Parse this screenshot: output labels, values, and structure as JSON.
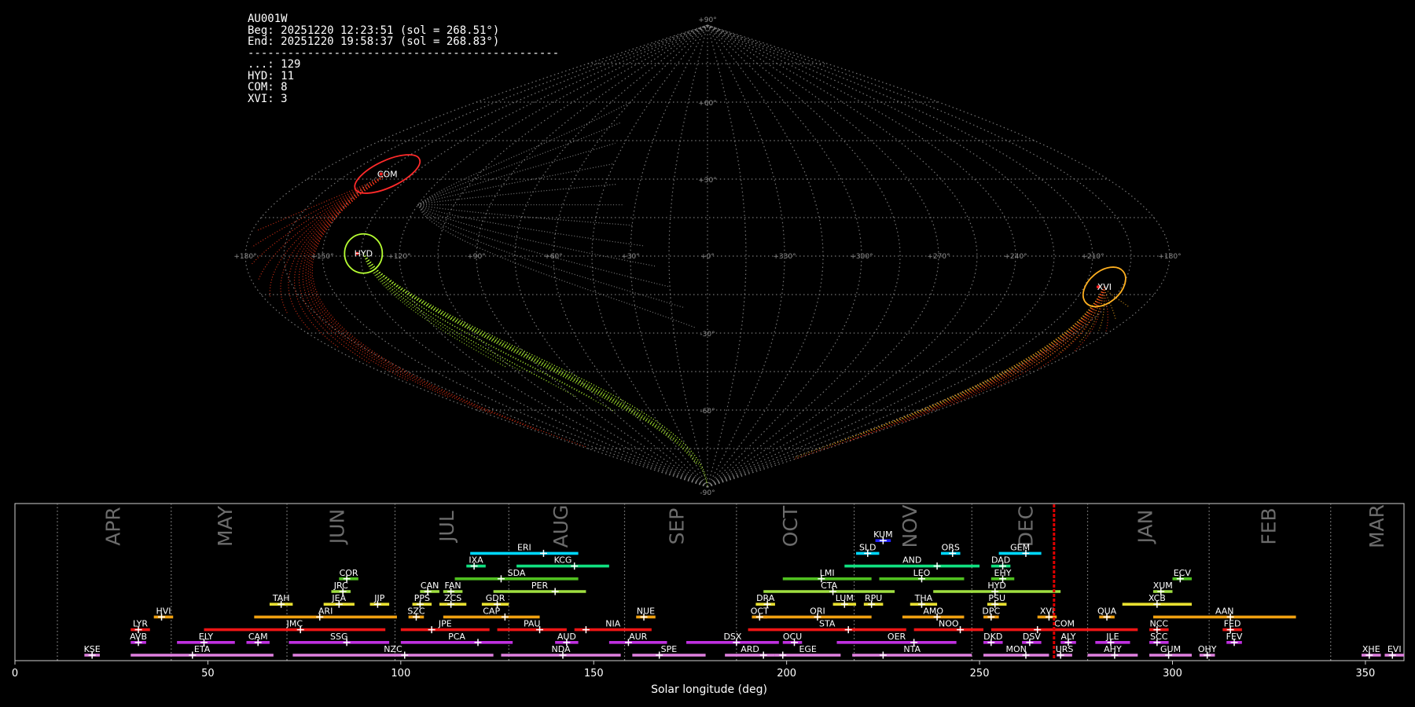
{
  "info": {
    "station": "AU001W",
    "begin": "Beg: 20251220 12:23:51 (sol = 268.51°)",
    "end": "End: 20251220 19:58:37 (sol = 268.83°)",
    "separator": "-----------------------------------------------",
    "counts": [
      "...: 129",
      "HYD: 11",
      "COM: 8",
      "XVI: 3"
    ]
  },
  "chart_data": [
    {
      "type": "scatter",
      "projection": "sinusoidal",
      "lat_ticks": [
        {
          "lat": 90,
          "label": "+90°"
        },
        {
          "lat": 60,
          "label": "+60°"
        },
        {
          "lat": 30,
          "label": "+30°"
        },
        {
          "lat": -30,
          "label": "-30°"
        },
        {
          "lat": -60,
          "label": "-60°"
        },
        {
          "lat": -90,
          "label": "-90°"
        }
      ],
      "lon_ticks": [
        {
          "lon": -180,
          "label": "+180°"
        },
        {
          "lon": -150,
          "label": "+150°"
        },
        {
          "lon": -120,
          "label": "+120°"
        },
        {
          "lon": -90,
          "label": "+90°"
        },
        {
          "lon": -60,
          "label": "+60°"
        },
        {
          "lon": -30,
          "label": "+30°"
        },
        {
          "lon": 0,
          "label": "+0°"
        },
        {
          "lon": 30,
          "label": "+330°"
        },
        {
          "lon": 60,
          "label": "+300°"
        },
        {
          "lon": 90,
          "label": "+270°"
        },
        {
          "lon": 120,
          "label": "+240°"
        },
        {
          "lon": 150,
          "label": "+210°"
        },
        {
          "lon": 180,
          "label": "+180°"
        }
      ],
      "radiants": [
        {
          "code": "COM",
          "lon": -147,
          "lat": 32,
          "color": "#ff2a2a"
        },
        {
          "code": "HYD",
          "lon": -134,
          "lat": 1,
          "color": "#b7ff33"
        },
        {
          "code": "XVI",
          "lon": 158,
          "lat": -12,
          "color": "#ffb020"
        }
      ]
    },
    {
      "type": "bar",
      "xlabel": "Solar longitude (deg)",
      "xlim": [
        0,
        360
      ],
      "xticks": [
        0,
        50,
        100,
        150,
        200,
        250,
        300,
        350
      ],
      "current_sol": 269.3,
      "month_boundaries": [
        11,
        40.5,
        70.5,
        98.5,
        128,
        158,
        187,
        217.5,
        248,
        278,
        309.5,
        341
      ],
      "months": [
        {
          "name": "APR",
          "pos": 25.5
        },
        {
          "name": "MAY",
          "pos": 54.5
        },
        {
          "name": "JUN",
          "pos": 83.5
        },
        {
          "name": "JUL",
          "pos": 112
        },
        {
          "name": "AUG",
          "pos": 141.5
        },
        {
          "name": "SEP",
          "pos": 171.5
        },
        {
          "name": "OCT",
          "pos": 201
        },
        {
          "name": "NOV",
          "pos": 232
        },
        {
          "name": "DEC",
          "pos": 262
        },
        {
          "name": "JAN",
          "pos": 293
        },
        {
          "name": "FEB",
          "pos": 325
        },
        {
          "name": "MAR",
          "pos": 353
        }
      ],
      "showers": [
        {
          "code": "KUM",
          "start": 223,
          "end": 227,
          "peak": 225,
          "row": 9,
          "color": "#2222ff"
        },
        {
          "code": "ERI",
          "start": 118,
          "end": 146,
          "peak": 137,
          "row": 8,
          "color": "#00d8ff"
        },
        {
          "code": "SLD",
          "start": 218,
          "end": 224,
          "peak": 221,
          "row": 8,
          "color": "#00d8ff"
        },
        {
          "code": "ORS",
          "start": 240,
          "end": 245,
          "peak": 243,
          "row": 8,
          "color": "#00d8ff"
        },
        {
          "code": "GEM",
          "start": 255,
          "end": 266,
          "peak": 262,
          "row": 8,
          "color": "#00d8ff"
        },
        {
          "code": "IXA",
          "start": 117,
          "end": 122,
          "peak": 119,
          "row": 7,
          "color": "#10e080"
        },
        {
          "code": "KCG",
          "start": 130,
          "end": 154,
          "peak": 145,
          "row": 7,
          "color": "#10e080"
        },
        {
          "code": "AND",
          "start": 215,
          "end": 250,
          "peak": 239,
          "row": 7,
          "color": "#10e080"
        },
        {
          "code": "DAD",
          "start": 253,
          "end": 258,
          "peak": 256,
          "row": 7,
          "color": "#10e080"
        },
        {
          "code": "COR",
          "start": 84,
          "end": 89,
          "peak": 86,
          "row": 6,
          "color": "#50c020"
        },
        {
          "code": "SDA",
          "start": 114,
          "end": 146,
          "peak": 126,
          "row": 6,
          "color": "#50c020"
        },
        {
          "code": "LMI",
          "start": 199,
          "end": 222,
          "peak": 209,
          "row": 6,
          "color": "#50c020"
        },
        {
          "code": "LEO",
          "start": 224,
          "end": 246,
          "peak": 235,
          "row": 6,
          "color": "#50c020"
        },
        {
          "code": "EHY",
          "start": 253,
          "end": 259,
          "peak": 256,
          "row": 6,
          "color": "#50c020"
        },
        {
          "code": "ECV",
          "start": 300,
          "end": 305,
          "peak": 302,
          "row": 6,
          "color": "#50c020"
        },
        {
          "code": "JRC",
          "start": 82,
          "end": 87,
          "peak": 85,
          "row": 5,
          "color": "#a0e040"
        },
        {
          "code": "CAN",
          "start": 105,
          "end": 110,
          "peak": 107,
          "row": 5,
          "color": "#a0e040"
        },
        {
          "code": "FAN",
          "start": 111,
          "end": 116,
          "peak": 113,
          "row": 5,
          "color": "#a0e040"
        },
        {
          "code": "PER",
          "start": 124,
          "end": 148,
          "peak": 140,
          "row": 5,
          "color": "#a0e040"
        },
        {
          "code": "CTA",
          "start": 194,
          "end": 228,
          "peak": 212,
          "row": 5,
          "color": "#a0e040"
        },
        {
          "code": "HYD",
          "start": 238,
          "end": 271,
          "peak": 254,
          "row": 5,
          "color": "#a0e040"
        },
        {
          "code": "XUM",
          "start": 295,
          "end": 300,
          "peak": 297,
          "row": 5,
          "color": "#a0e040"
        },
        {
          "code": "TAH",
          "start": 66,
          "end": 72,
          "peak": 69,
          "row": 4,
          "color": "#e8e030"
        },
        {
          "code": "JEA",
          "start": 80,
          "end": 88,
          "peak": 84,
          "row": 4,
          "color": "#e8e030"
        },
        {
          "code": "JIP",
          "start": 92,
          "end": 97,
          "peak": 94,
          "row": 4,
          "color": "#e8e030"
        },
        {
          "code": "PPS",
          "start": 103,
          "end": 108,
          "peak": 105,
          "row": 4,
          "color": "#e8e030"
        },
        {
          "code": "ZCS",
          "start": 110,
          "end": 117,
          "peak": 113,
          "row": 4,
          "color": "#e8e030"
        },
        {
          "code": "GDR",
          "start": 121,
          "end": 128,
          "peak": 125,
          "row": 4,
          "color": "#e8e030"
        },
        {
          "code": "DRA",
          "start": 192,
          "end": 197,
          "peak": 195,
          "row": 4,
          "color": "#e8e030"
        },
        {
          "code": "LUM",
          "start": 212,
          "end": 218,
          "peak": 215,
          "row": 4,
          "color": "#e8e030"
        },
        {
          "code": "RPU",
          "start": 220,
          "end": 225,
          "peak": 222,
          "row": 4,
          "color": "#e8e030"
        },
        {
          "code": "THA",
          "start": 232,
          "end": 239,
          "peak": 235,
          "row": 4,
          "color": "#e8e030"
        },
        {
          "code": "PSU",
          "start": 252,
          "end": 257,
          "peak": 254,
          "row": 4,
          "color": "#e8e030"
        },
        {
          "code": "XCB",
          "start": 287,
          "end": 305,
          "peak": 296,
          "row": 4,
          "color": "#e8e030"
        },
        {
          "code": "HVI",
          "start": 36,
          "end": 41,
          "peak": 38,
          "row": 3,
          "color": "#f0a010"
        },
        {
          "code": "ARI",
          "start": 62,
          "end": 99,
          "peak": 79,
          "row": 3,
          "color": "#f0a010"
        },
        {
          "code": "SZC",
          "start": 102,
          "end": 106,
          "peak": 104,
          "row": 3,
          "color": "#f0a010"
        },
        {
          "code": "CAP",
          "start": 111,
          "end": 136,
          "peak": 127,
          "row": 3,
          "color": "#f0a010"
        },
        {
          "code": "NUE",
          "start": 161,
          "end": 166,
          "peak": 163,
          "row": 3,
          "color": "#f0a010"
        },
        {
          "code": "OCT",
          "start": 191,
          "end": 195,
          "peak": 193,
          "row": 3,
          "color": "#f0a010"
        },
        {
          "code": "ORI",
          "start": 194,
          "end": 222,
          "peak": 208,
          "row": 3,
          "color": "#f0a010"
        },
        {
          "code": "AMO",
          "start": 230,
          "end": 246,
          "peak": 239,
          "row": 3,
          "color": "#f0a010"
        },
        {
          "code": "DPC",
          "start": 251,
          "end": 255,
          "peak": 253,
          "row": 3,
          "color": "#f0a010"
        },
        {
          "code": "XVI",
          "start": 265,
          "end": 270,
          "peak": 268,
          "row": 3,
          "color": "#f0a010"
        },
        {
          "code": "QUA",
          "start": 281,
          "end": 285,
          "peak": 283,
          "row": 3,
          "color": "#f0a010"
        },
        {
          "code": "AAN",
          "start": 295,
          "end": 332,
          "peak": 315,
          "row": 3,
          "color": "#f0a010"
        },
        {
          "code": "LYR",
          "start": 30,
          "end": 35,
          "peak": 32,
          "row": 2,
          "color": "#ee1515"
        },
        {
          "code": "JMC",
          "start": 49,
          "end": 96,
          "peak": 74,
          "row": 2,
          "color": "#ee1515"
        },
        {
          "code": "JPE",
          "start": 100,
          "end": 123,
          "peak": 108,
          "row": 2,
          "color": "#ee1515"
        },
        {
          "code": "PAU",
          "start": 125,
          "end": 143,
          "peak": 136,
          "row": 2,
          "color": "#ee1515"
        },
        {
          "code": "NIA",
          "start": 145,
          "end": 165,
          "peak": 148,
          "row": 2,
          "color": "#ee1515"
        },
        {
          "code": "STA",
          "start": 190,
          "end": 231,
          "peak": 216,
          "row": 2,
          "color": "#ee1515"
        },
        {
          "code": "NOO",
          "start": 233,
          "end": 251,
          "peak": 245,
          "row": 2,
          "color": "#ee1515"
        },
        {
          "code": "COM",
          "start": 253,
          "end": 291,
          "peak": 265,
          "row": 2,
          "color": "#ee1515"
        },
        {
          "code": "NCC",
          "start": 294,
          "end": 299,
          "peak": 296,
          "row": 2,
          "color": "#ee1515"
        },
        {
          "code": "FED",
          "start": 313,
          "end": 318,
          "peak": 315,
          "row": 2,
          "color": "#ee1515"
        },
        {
          "code": "AVB",
          "start": 30,
          "end": 34,
          "peak": 32,
          "row": 1,
          "color": "#c030e0"
        },
        {
          "code": "ELY",
          "start": 42,
          "end": 57,
          "peak": 49,
          "row": 1,
          "color": "#c030e0"
        },
        {
          "code": "CAM",
          "start": 60,
          "end": 66,
          "peak": 63,
          "row": 1,
          "color": "#c030e0"
        },
        {
          "code": "SSG",
          "start": 71,
          "end": 97,
          "peak": 86,
          "row": 1,
          "color": "#c030e0"
        },
        {
          "code": "PCA",
          "start": 100,
          "end": 129,
          "peak": 120,
          "row": 1,
          "color": "#c030e0"
        },
        {
          "code": "AUD",
          "start": 140,
          "end": 146,
          "peak": 143,
          "row": 1,
          "color": "#c030e0"
        },
        {
          "code": "AUR",
          "start": 154,
          "end": 169,
          "peak": 159,
          "row": 1,
          "color": "#c030e0"
        },
        {
          "code": "DSX",
          "start": 174,
          "end": 198,
          "peak": 187,
          "row": 1,
          "color": "#c030e0"
        },
        {
          "code": "OCU",
          "start": 199,
          "end": 204,
          "peak": 202,
          "row": 1,
          "color": "#c030e0"
        },
        {
          "code": "OER",
          "start": 213,
          "end": 244,
          "peak": 233,
          "row": 1,
          "color": "#c030e0"
        },
        {
          "code": "DKD",
          "start": 251,
          "end": 256,
          "peak": 253,
          "row": 1,
          "color": "#c030e0"
        },
        {
          "code": "DSV",
          "start": 261,
          "end": 266,
          "peak": 263,
          "row": 1,
          "color": "#c030e0"
        },
        {
          "code": "ALY",
          "start": 271,
          "end": 275,
          "peak": 273,
          "row": 1,
          "color": "#c030e0"
        },
        {
          "code": "JLE",
          "start": 280,
          "end": 289,
          "peak": 284,
          "row": 1,
          "color": "#c030e0"
        },
        {
          "code": "SCC",
          "start": 294,
          "end": 299,
          "peak": 296,
          "row": 1,
          "color": "#c030e0"
        },
        {
          "code": "FEV",
          "start": 314,
          "end": 318,
          "peak": 316,
          "row": 1,
          "color": "#c030e0"
        },
        {
          "code": "KSE",
          "start": 18,
          "end": 22,
          "peak": 20,
          "row": 0,
          "color": "#e080e0"
        },
        {
          "code": "ETA",
          "start": 30,
          "end": 67,
          "peak": 46,
          "row": 0,
          "color": "#e080e0"
        },
        {
          "code": "NZC",
          "start": 72,
          "end": 124,
          "peak": 101,
          "row": 0,
          "color": "#e080e0"
        },
        {
          "code": "NDA",
          "start": 126,
          "end": 157,
          "peak": 142,
          "row": 0,
          "color": "#e080e0"
        },
        {
          "code": "SPE",
          "start": 160,
          "end": 179,
          "peak": 167,
          "row": 0,
          "color": "#e080e0"
        },
        {
          "code": "ARD",
          "start": 184,
          "end": 197,
          "peak": 194,
          "row": 0,
          "color": "#e080e0"
        },
        {
          "code": "EGE",
          "start": 197,
          "end": 214,
          "peak": 199,
          "row": 0,
          "color": "#e080e0"
        },
        {
          "code": "NTA",
          "start": 217,
          "end": 248,
          "peak": 225,
          "row": 0,
          "color": "#e080e0"
        },
        {
          "code": "MON",
          "start": 251,
          "end": 268,
          "peak": 262,
          "row": 0,
          "color": "#e080e0"
        },
        {
          "code": "URS",
          "start": 270,
          "end": 274,
          "peak": 271,
          "row": 0,
          "color": "#e080e0"
        },
        {
          "code": "AHY",
          "start": 278,
          "end": 291,
          "peak": 285,
          "row": 0,
          "color": "#e080e0"
        },
        {
          "code": "GUM",
          "start": 294,
          "end": 305,
          "peak": 299,
          "row": 0,
          "color": "#e080e0"
        },
        {
          "code": "OHY",
          "start": 307,
          "end": 311,
          "peak": 309,
          "row": 0,
          "color": "#e080e0"
        },
        {
          "code": "XHE",
          "start": 349,
          "end": 354,
          "peak": 351,
          "row": 0,
          "color": "#e080e0"
        },
        {
          "code": "EVI",
          "start": 355,
          "end": 360,
          "peak": 357,
          "row": 0,
          "color": "#e080e0"
        }
      ]
    }
  ]
}
